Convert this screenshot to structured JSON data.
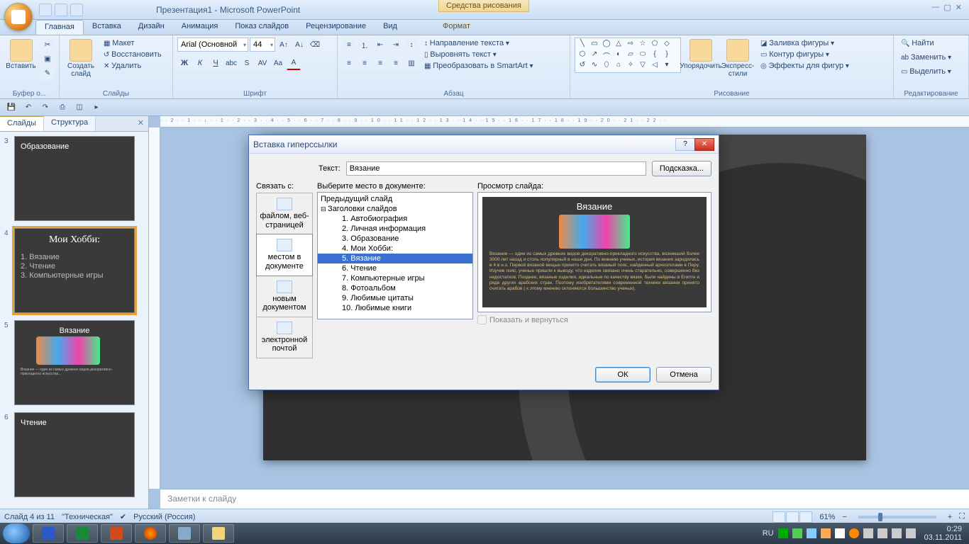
{
  "title": {
    "text": "Презентация1 - Microsoft PowerPoint",
    "context_tab": "Средства рисования"
  },
  "win_controls": {
    "min": "—",
    "max": "▢",
    "close": "✕"
  },
  "ribbon_tabs": [
    "Главная",
    "Вставка",
    "Дизайн",
    "Анимация",
    "Показ слайдов",
    "Рецензирование",
    "Вид",
    "",
    "Формат"
  ],
  "ribbon": {
    "clipboard": {
      "paste": "Вставить",
      "label": "Буфер о..."
    },
    "slides": {
      "new": "Создать слайд",
      "layout": "Макет",
      "restore": "Восстановить",
      "delete": "Удалить",
      "label": "Слайды"
    },
    "font": {
      "name": "Arial (Основной",
      "size": "44",
      "label": "Шрифт"
    },
    "para": {
      "dir": "Направление текста",
      "align": "Выровнять текст",
      "smartart": "Преобразовать в SmartArt",
      "label": "Абзац"
    },
    "drawing": {
      "arrange": "Упорядочить",
      "styles": "Экспресс-стили",
      "fill": "Заливка фигуры",
      "outline": "Контур фигуры",
      "effects": "Эффекты для фигур",
      "label": "Рисование"
    },
    "editing": {
      "find": "Найти",
      "replace": "Заменить",
      "select": "Выделить",
      "label": "Редактирование"
    }
  },
  "sidepanel": {
    "tabs": [
      "Слайды",
      "Структура"
    ],
    "thumbs": [
      {
        "num": "3",
        "title": "Образование"
      },
      {
        "num": "4",
        "title": "Мои Хобби:",
        "lines": [
          "1. Вязание",
          "2. Чтение",
          "3. Компьютерные игры"
        ],
        "selected": true
      },
      {
        "num": "5",
        "title": "Вязание",
        "yarn": true,
        "body": "Вязание — один из самых древних видов декоративно-прикладного искусства..."
      },
      {
        "num": "6",
        "title": "Чтение"
      }
    ]
  },
  "ruler": "··2··1··↓··1··2··3··4··5··6··7··8··9··10··11··12··13··14··15··16··17··18··19··20··21··22··",
  "notes": "Заметки к слайду",
  "status": {
    "slide": "Слайд 4 из 11",
    "theme": "\"Техническая\"",
    "lang": "Русский (Россия)",
    "zoom": "61%"
  },
  "dialog": {
    "title": "Вставка гиперссылки",
    "link_label": "Связать с:",
    "text_label": "Текст:",
    "text_value": "Вязание",
    "hint_btn": "Подсказка...",
    "select_label": "Выберите место в документе:",
    "preview_label": "Просмотр слайда:",
    "link_types": [
      {
        "label": "файлом, веб-страницей"
      },
      {
        "label": "местом в документе",
        "selected": true
      },
      {
        "label": "новым документом"
      },
      {
        "label": "электронной почтой"
      }
    ],
    "tree": [
      {
        "label": "Предыдущий слайд",
        "level": 1,
        "leaf": true
      },
      {
        "label": "Заголовки слайдов",
        "level": 1
      },
      {
        "label": "1. Автобиография",
        "level": 2
      },
      {
        "label": "2. Личная информация",
        "level": 2
      },
      {
        "label": "3. Образование",
        "level": 2
      },
      {
        "label": "4. Мои Хобби:",
        "level": 2
      },
      {
        "label": "5. Вязание",
        "level": 2,
        "selected": true
      },
      {
        "label": "6. Чтение",
        "level": 2
      },
      {
        "label": "7. Компьютерные игры",
        "level": 2
      },
      {
        "label": "8. Фотоальбом",
        "level": 2
      },
      {
        "label": "9. Любимые цитаты",
        "level": 2
      },
      {
        "label": "10. Любимые книги",
        "level": 2
      }
    ],
    "preview_title": "Вязание",
    "preview_body": "Вязание — один из самых древних видов декоративно-прикладного искусства, возникший более 3000 лет назад и столь популярный в наши дни. По мнению ученых, история вязания зародилась в 4 в н.э. Первой вязаной вещью принято считать вязаный пояс, найденный археологами в Перу. Изучив пояс, ученые пришли к выводу, что изделие связано очень старательно, совершенно без недостатков. Позднее, вязаные изделия, идеальные по качеству вязки, были найдены в Египте и ряде других арабских стран. Поэтому изобретателями современной техники вязания принято считать арабов ( к этому мнению склоняются большинство ученых).",
    "show_return": "Показать и вернуться",
    "ok": "ОК",
    "cancel": "Отмена",
    "help": "?"
  },
  "taskbar": {
    "lang": "RU",
    "time": "0:29",
    "date": "03.11.2011"
  }
}
